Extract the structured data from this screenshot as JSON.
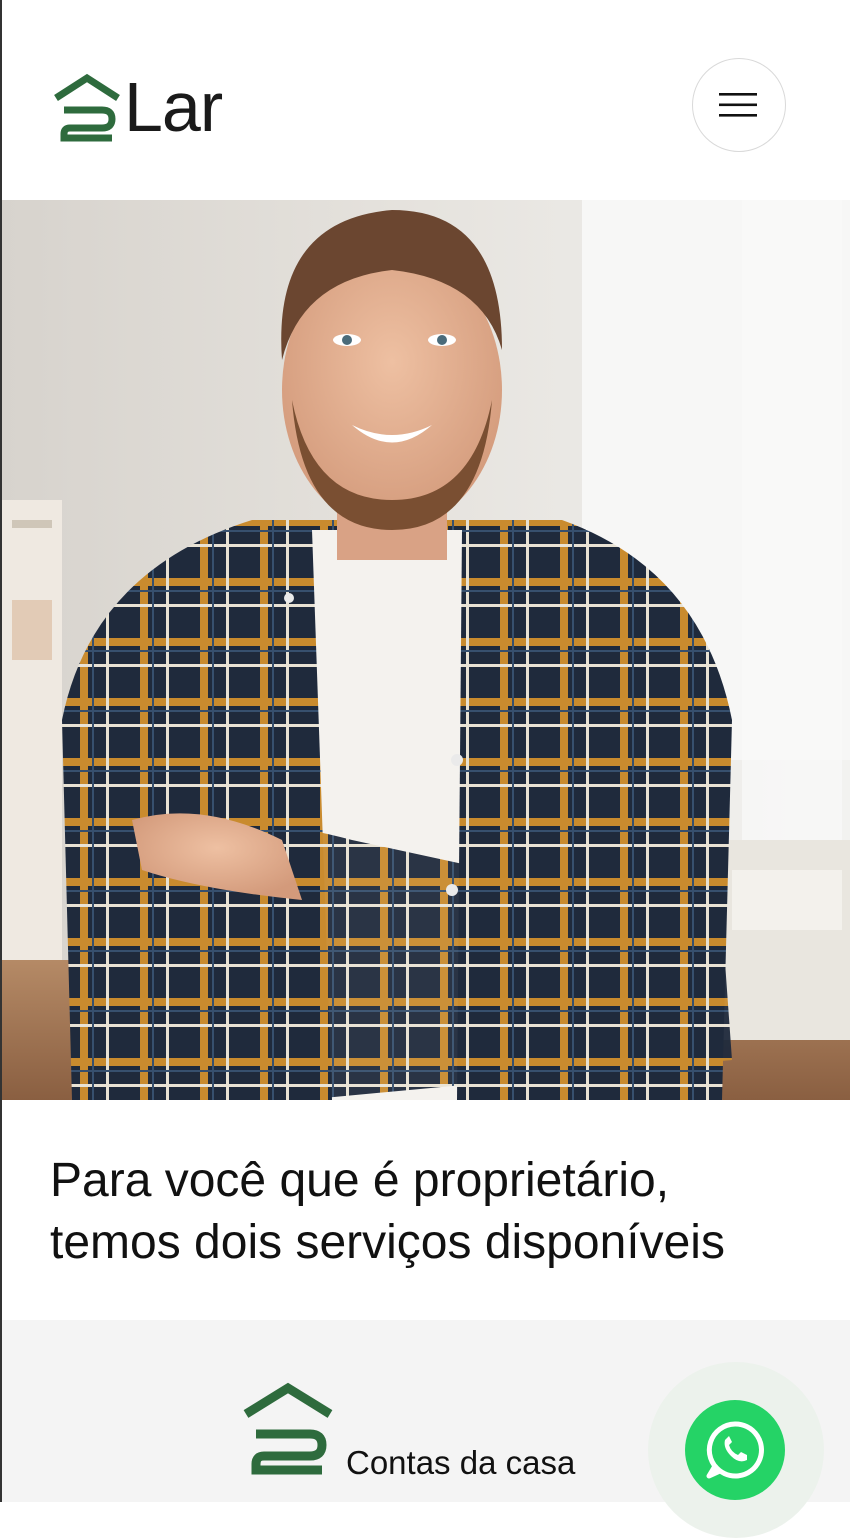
{
  "brand": {
    "name": "Lar",
    "accent_color": "#2e6b3d"
  },
  "header": {
    "menu_icon": "hamburger-icon"
  },
  "hero": {
    "image": "man-smiling-arms-crossed-plaid-shirt"
  },
  "headline": {
    "text": "Para você que é proprietário, temos dois serviços disponíveis"
  },
  "services": [
    {
      "label": "Contas da casa"
    }
  ],
  "whatsapp": {
    "icon": "whatsapp-icon",
    "color": "#25d366"
  }
}
